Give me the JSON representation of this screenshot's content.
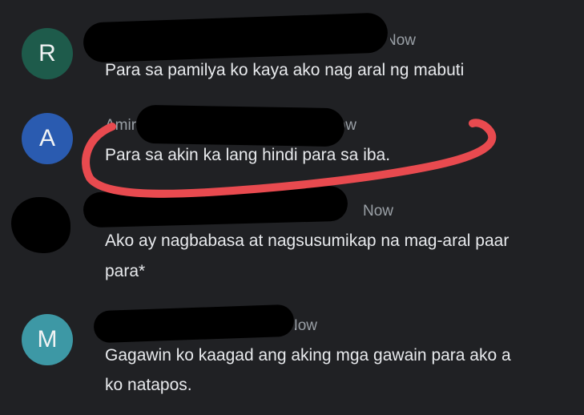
{
  "comments": [
    {
      "avatar_letter": "R",
      "avatar_color": "#1e5b4b",
      "author_visible": "",
      "time": "Now",
      "text": "Para sa pamilya ko kaya ako nag aral ng mabuti"
    },
    {
      "avatar_letter": "A",
      "avatar_color": "#2a5bb0",
      "author_visible": "Amir",
      "time": "Now",
      "text": "Para sa akin ka lang hindi para sa iba."
    },
    {
      "avatar_letter": "",
      "avatar_color": "#000000",
      "author_visible": "",
      "time": "Now",
      "text": "Ako ay nagbabasa at nagsusumikap na mag-aral paar",
      "text_line2": "para*"
    },
    {
      "avatar_letter": "M",
      "avatar_color": "#3d98a5",
      "author_visible": "",
      "time": "Now",
      "text": "Gagawin ko kaagad ang aking mga gawain para ako a",
      "text_line2": "ko natapos."
    }
  ],
  "annotation_color": "#e84a4f"
}
